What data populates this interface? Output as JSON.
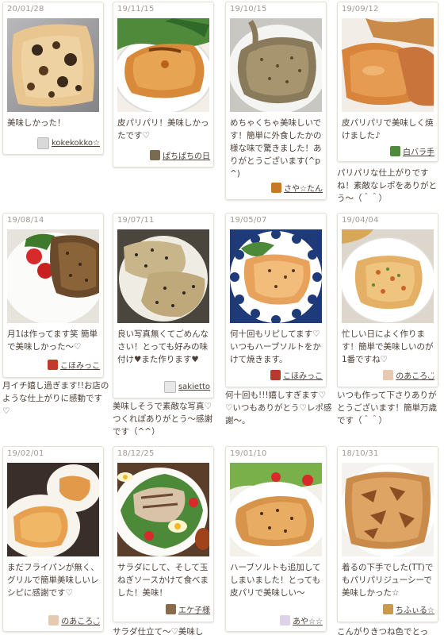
{
  "cards": [
    {
      "date": "20/01/28",
      "comment": "美味しかった！",
      "user": "kokekokko☆",
      "reply": ""
    },
    {
      "date": "19/11/15",
      "comment": "皮パリパリ！美味しかったです♡",
      "user": "ぱちぱちの日",
      "reply": ""
    },
    {
      "date": "19/10/15",
      "comment": "めちゃくちゃ美味しいです！簡単に外食したかの様な味で驚きました！ありがとうございます(^p^)",
      "user": "さや☆たん",
      "reply": ""
    },
    {
      "date": "19/09/12",
      "comment": "皮パリパリで美味しく焼けました♪",
      "user": "白バラ手",
      "reply": "パリパリな仕上がりですね！素敵なレポをありがとう～（＾＾）"
    },
    {
      "date": "19/08/14",
      "comment": "月1は作ってます笑 簡単で美味しかった～♡",
      "user": "こほみっこ",
      "reply": "月イチ嬉し過ぎます!!お店のような仕上がりに感動です♡"
    },
    {
      "date": "19/07/11",
      "comment": "良い写真無くてごめんなさい！とっても好みの味付け♥また作ります♥",
      "user": "sakietto",
      "reply": "美味しそうで素敵な写真♡つくれぽありがとう～感謝です（^^）"
    },
    {
      "date": "19/05/07",
      "comment": "何十回もリピしてます♡いつもハーブソルトをかけて焼きます。",
      "user": "こほみっこ",
      "reply": "何十回も!!!嬉しすぎます♡♡いつもありがとう♡レポ感謝～。"
    },
    {
      "date": "19/04/04",
      "comment": "忙しい日によく作ります！簡単で美味しいのが1番ですね♡",
      "user": "のあころ◡̈",
      "reply": "いつも作って下さりありがとうございます！簡単万歳です（＾＾）"
    },
    {
      "date": "19/02/01",
      "comment": "まだフライパンが無く、グリルで簡単美味しいレシピに感謝です♡",
      "user": "のあころ◡̈",
      "reply": ""
    },
    {
      "date": "18/12/25",
      "comment": "サラダにして、そして玉ねぎソースかけて食べました！美味！",
      "user": "エケ子様",
      "reply": "サラダ仕立て～♡美味し"
    },
    {
      "date": "19/01/10",
      "comment": "ハーブソルトも追加してしまいました！とっても皮パリで美味しい～",
      "user": "あや☆☆",
      "reply": ""
    },
    {
      "date": "18/10/31",
      "comment": "着るの下手でした(TT)でもパリパリジューシーで美味しかった☆",
      "user": "ちふぃる☆",
      "reply": "こんがりきつね色でとっ"
    }
  ],
  "colors": {
    "avatars": [
      "#d9d9d9",
      "#7a6a52",
      "#c47a2a",
      "#4f8a3c",
      "#c23b2a",
      "#e8e8e8",
      "#b83a2e",
      "#e6c9b0",
      "#e6c9b0",
      "#8a6a4a",
      "#ded2e8",
      "#c89a4a"
    ]
  }
}
